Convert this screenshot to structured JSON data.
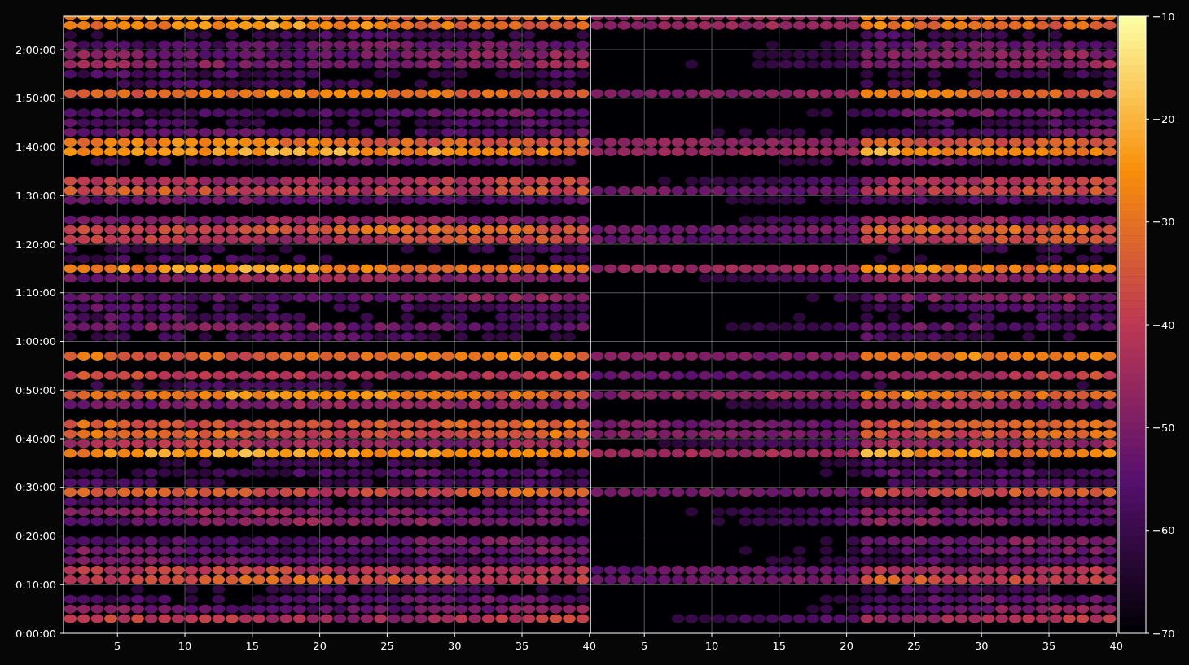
{
  "figure": {
    "yticks": [
      "2:00:00",
      "1:50:00",
      "1:40:00",
      "1:30:00",
      "1:20:00",
      "1:10:00",
      "1:00:00",
      "0:50:00",
      "0:40:00",
      "0:30:00",
      "0:20:00",
      "0:10:00",
      "0:00:00"
    ],
    "panels": [
      {
        "xticks": [
          "5",
          "10",
          "15",
          "20",
          "25",
          "30",
          "35",
          "40"
        ]
      },
      {
        "xticks": [
          "5",
          "10",
          "15",
          "20",
          "25",
          "30",
          "35",
          "40"
        ]
      }
    ],
    "colorbar": {
      "ticks": [
        "−10",
        "−20",
        "−30",
        "−40",
        "−50",
        "−60",
        "−70"
      ]
    }
  }
}
